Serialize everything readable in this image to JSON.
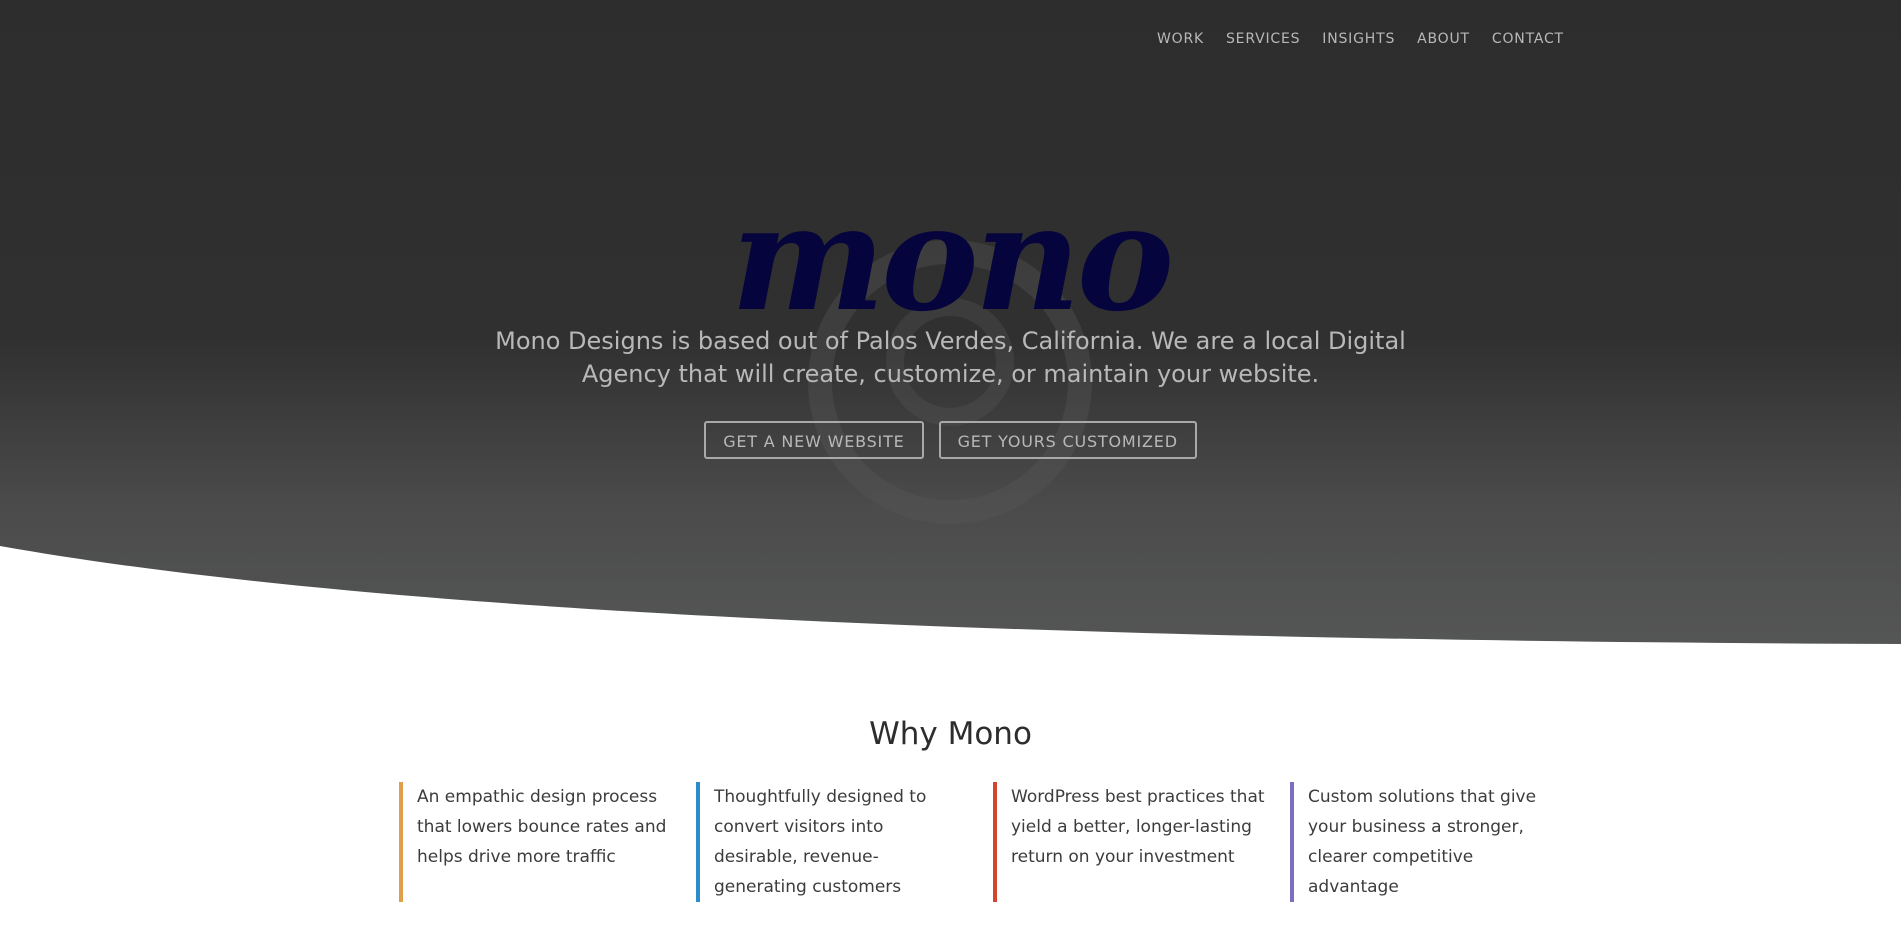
{
  "nav": {
    "items": [
      "WORK",
      "SERVICES",
      "INSIGHTS",
      "ABOUT",
      "CONTACT"
    ]
  },
  "hero": {
    "logo": "mono",
    "tagline_line1": "Mono Designs is based out of Palos Verdes, California. We are a local Digital",
    "tagline_line2": "Agency that will create, customize, or maintain your website.",
    "button_new": "GET A NEW WEBSITE",
    "button_custom": "GET YOURS CUSTOMIZED"
  },
  "why": {
    "title": "Why Mono",
    "features": [
      {
        "text": "An empathic design process that lowers bounce rates and helps drive more traffic",
        "color": "#e0a04a"
      },
      {
        "text": "Thoughtfully designed to convert visitors into desirable, revenue-generating customers",
        "color": "#2a8fc8"
      },
      {
        "text": "WordPress best practices that yield a better, longer-lasting return on your investment",
        "color": "#d6442f"
      },
      {
        "text": "Custom solutions that give your business a stronger, clearer competitive advantage",
        "color": "#7b6fc4"
      }
    ]
  },
  "colors": {
    "hero_dark": "#2d2d2d",
    "hero_light": "#555656",
    "logo": "#05043c",
    "text_muted": "#b8b8b8"
  }
}
